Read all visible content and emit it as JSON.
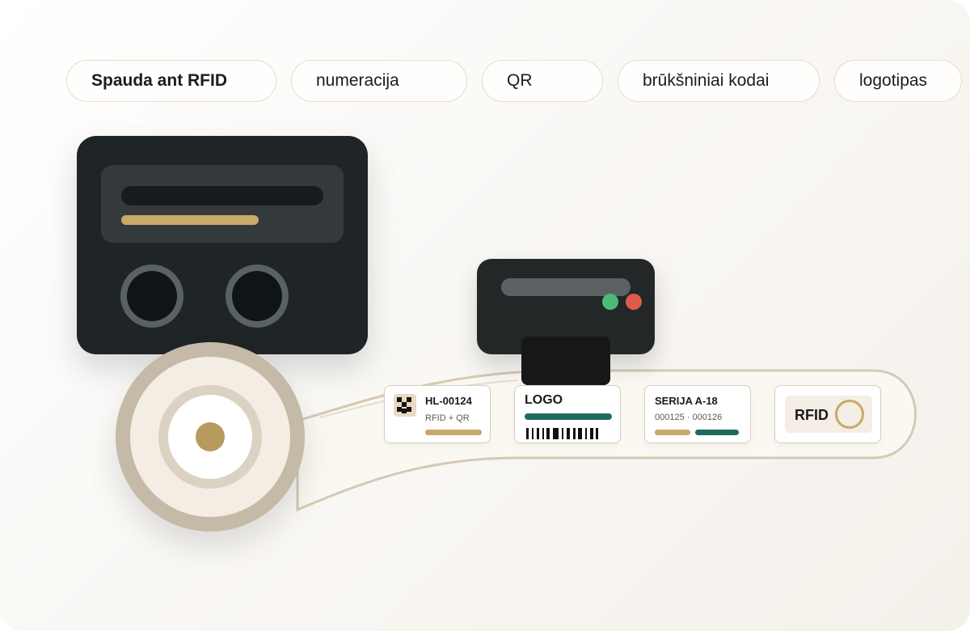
{
  "tabs": [
    {
      "label": "Spauda ant RFID",
      "active": true
    },
    {
      "label": "numeracija",
      "active": false
    },
    {
      "label": "QR",
      "active": false
    },
    {
      "label": "brūkšniniai kodai",
      "active": false
    },
    {
      "label": "logotipas",
      "active": false
    }
  ],
  "labels": {
    "qr_label": {
      "title": "HL-00124",
      "subtitle": "RFID + QR"
    },
    "logo_label": {
      "title": "LOGO"
    },
    "serial_label": {
      "title": "SERIJA A-18",
      "range": "000125 · 000126"
    },
    "rfid_label": {
      "title": "RFID"
    }
  },
  "colors": {
    "accent_gold": "#c9a96a",
    "accent_teal": "#1e6b5c",
    "led_green": "#4fb97a",
    "led_red": "#de5a4a",
    "device_dark": "#1f2526"
  },
  "icons": [
    "qr-code-icon",
    "barcode-icon",
    "rfid-ring-icon"
  ]
}
